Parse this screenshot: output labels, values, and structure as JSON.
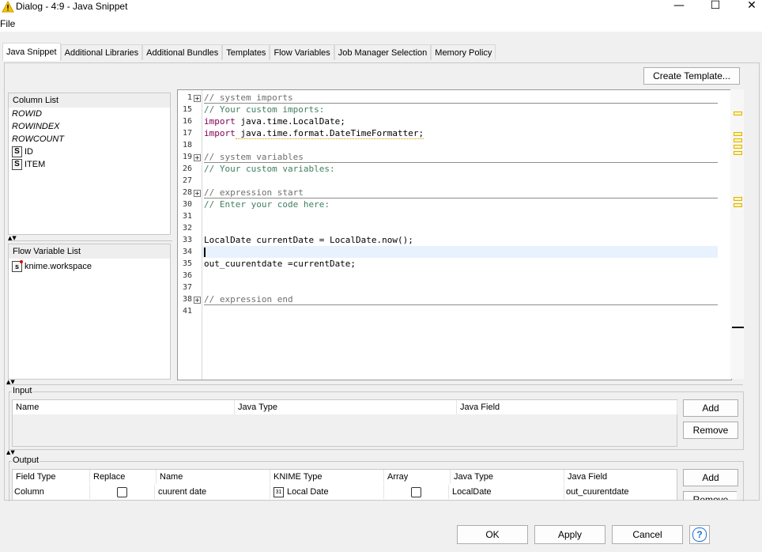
{
  "window": {
    "title": "Dialog - 4:9 - Java Snippet",
    "minimize_glyph": "—",
    "maximize_glyph": "☐",
    "close_glyph": "✕",
    "icon": "warning-triangle-icon"
  },
  "menu": {
    "file": "File"
  },
  "tabs": [
    "Java Snippet",
    "Additional Libraries",
    "Additional Bundles",
    "Templates",
    "Flow Variables",
    "Job Manager Selection",
    "Memory Policy"
  ],
  "create_template_label": "Create Template...",
  "column_list": {
    "header": "Column List",
    "special": [
      "ROWID",
      "ROWINDEX",
      "ROWCOUNT"
    ],
    "columns": [
      {
        "icon": "S",
        "name": "ID"
      },
      {
        "icon": "S",
        "name": "ITEM"
      }
    ]
  },
  "flow_variable_list": {
    "header": "Flow Variable List",
    "items": [
      {
        "icon": "s",
        "name": "knime.workspace"
      }
    ]
  },
  "editor": {
    "lines": [
      {
        "n": "1",
        "fold": true,
        "text": "// system imports",
        "style": "cmtgray",
        "sep_after": true
      },
      {
        "n": "15",
        "fold": false,
        "text": "// Your custom imports:",
        "style": "cmt"
      },
      {
        "n": "16",
        "fold": false,
        "kw": "import",
        "text": " java.time.LocalDate;",
        "style": "code"
      },
      {
        "n": "17",
        "fold": false,
        "kw": "import",
        "text": " java.time.format.DateTimeFormatter;",
        "style": "code",
        "warn": true
      },
      {
        "n": "18",
        "fold": false,
        "text": "",
        "style": "code"
      },
      {
        "n": "19",
        "fold": true,
        "text": "// system variables",
        "style": "cmtgray",
        "sep_after": true
      },
      {
        "n": "26",
        "fold": false,
        "text": "// Your custom variables:",
        "style": "cmt"
      },
      {
        "n": "27",
        "fold": false,
        "text": "",
        "style": "code"
      },
      {
        "n": "28",
        "fold": true,
        "text": "// expression start",
        "style": "cmtgray",
        "sep_after": true
      },
      {
        "n": "30",
        "fold": false,
        "text": "// Enter your code here:",
        "style": "cmt"
      },
      {
        "n": "31",
        "fold": false,
        "text": "",
        "style": "code"
      },
      {
        "n": "32",
        "fold": false,
        "text": "",
        "style": "code"
      },
      {
        "n": "33",
        "fold": false,
        "text": "LocalDate currentDate = LocalDate.now();",
        "style": "code"
      },
      {
        "n": "34",
        "fold": false,
        "text": "",
        "style": "code",
        "current": true
      },
      {
        "n": "35",
        "fold": false,
        "text": "out_cuurentdate =currentDate;",
        "style": "code"
      },
      {
        "n": "36",
        "fold": false,
        "text": "",
        "style": "code"
      },
      {
        "n": "37",
        "fold": false,
        "text": "",
        "style": "code"
      },
      {
        "n": "38",
        "fold": true,
        "text": "// expression end",
        "style": "cmtgray",
        "sep_after": true
      },
      {
        "n": "41",
        "fold": false,
        "text": "",
        "style": "code"
      }
    ]
  },
  "input": {
    "title": "Input",
    "headers": [
      "Name",
      "Java Type",
      "Java Field"
    ],
    "add": "Add",
    "remove": "Remove"
  },
  "output": {
    "title": "Output",
    "headers": [
      "Field Type",
      "Replace",
      "Name",
      "KNIME Type",
      "Array",
      "Java Type",
      "Java Field"
    ],
    "rows": [
      {
        "field_type": "Column",
        "replace": false,
        "name": "cuurent date",
        "knime_type_icon": "31",
        "knime_type": "Local Date",
        "array": false,
        "java_type": "LocalDate",
        "java_field": "out_cuurentdate"
      }
    ],
    "add": "Add",
    "remove": "Remove"
  },
  "footer": {
    "ok": "OK",
    "apply": "Apply",
    "cancel": "Cancel",
    "help": "?"
  },
  "colors": {
    "comment": "#3f7f5f",
    "keyword": "#7f0055",
    "current_line": "#e8f2fe",
    "help_blue": "#1e6fd9"
  }
}
